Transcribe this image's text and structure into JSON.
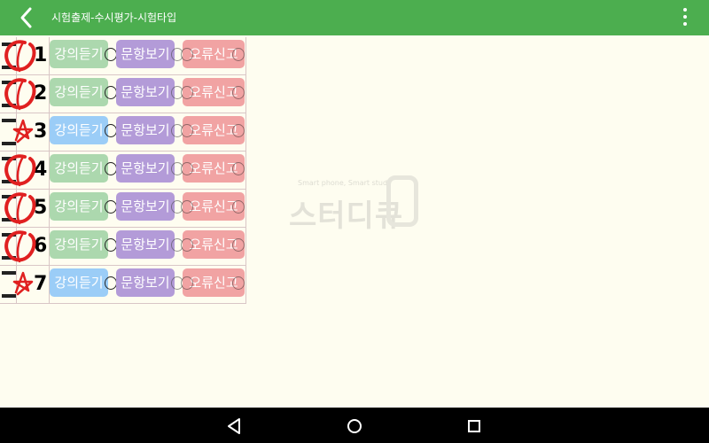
{
  "appbar": {
    "title": "시험출제-수시평가-시험타입"
  },
  "rows": [
    {
      "number": "1",
      "mark": "correct",
      "lecture_color": "green"
    },
    {
      "number": "2",
      "mark": "correct",
      "lecture_color": "green"
    },
    {
      "number": "3",
      "mark": "star",
      "lecture_color": "blue"
    },
    {
      "number": "4",
      "mark": "correct",
      "lecture_color": "green"
    },
    {
      "number": "5",
      "mark": "correct",
      "lecture_color": "green"
    },
    {
      "number": "6",
      "mark": "correct",
      "lecture_color": "green"
    },
    {
      "number": "7",
      "mark": "star",
      "lecture_color": "blue"
    }
  ],
  "buttons": {
    "lecture_label": "강의듣기",
    "view_label": "문항보기",
    "report_label": "오류신고"
  },
  "watermark": {
    "tagline": "Smart phone, Smart study",
    "logo_text": "스터디큐"
  },
  "colors": {
    "appbar": "#4cae4f",
    "lecture_green": "#acd8ae",
    "lecture_blue": "#9bcdf7",
    "view": "#b39bd8",
    "report": "#f1a3a3",
    "mark_red": "#e02020"
  },
  "icons": {
    "back": "back-arrow-icon",
    "menu": "more-vert-icon",
    "nav_back": "triangle-back-icon",
    "nav_home": "circle-home-icon",
    "nav_recent": "square-recent-icon"
  }
}
